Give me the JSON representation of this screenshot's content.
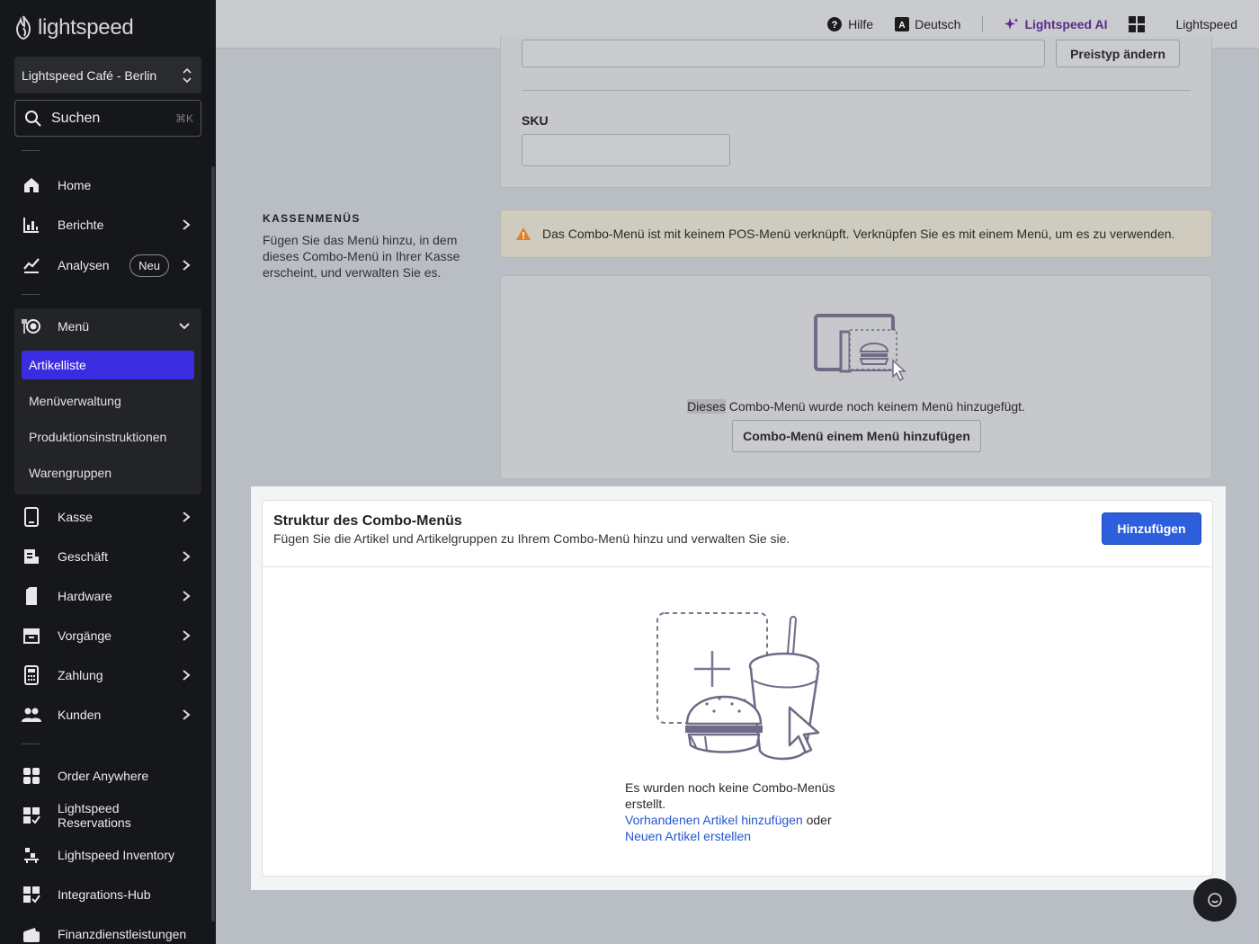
{
  "sidebar": {
    "logo_text": "lightspeed",
    "store_name": "Lightspeed Café - Berlin",
    "search": {
      "label": "Suchen",
      "shortcut": "⌘K"
    },
    "nav": [
      {
        "label": "Home",
        "icon": "home-icon"
      },
      {
        "label": "Berichte",
        "icon": "reports-icon"
      },
      {
        "label": "Analysen",
        "icon": "analytics-icon",
        "badge": "Neu"
      }
    ],
    "menu": {
      "label": "Menü",
      "icon": "menu-icon",
      "items": [
        "Artikelliste",
        "Menüverwaltung",
        "Produktionsinstruktionen",
        "Warengruppen"
      ],
      "active_item": "Artikelliste"
    },
    "nav2": [
      {
        "label": "Kasse",
        "icon": "pos-device-icon"
      },
      {
        "label": "Geschäft",
        "icon": "business-icon"
      },
      {
        "label": "Hardware",
        "icon": "hardware-icon"
      },
      {
        "label": "Vorgänge",
        "icon": "transactions-icon"
      },
      {
        "label": "Zahlung",
        "icon": "payment-terminal-icon"
      },
      {
        "label": "Kunden",
        "icon": "customers-icon"
      }
    ],
    "nav3": [
      {
        "label": "Order Anywhere",
        "icon": "order-anywhere-icon"
      },
      {
        "label": "Lightspeed Reservations",
        "icon": "reservations-icon"
      },
      {
        "label": "Lightspeed Inventory",
        "icon": "inventory-icon"
      },
      {
        "label": "Integrations-Hub",
        "icon": "integrations-icon"
      },
      {
        "label": "Finanzdienstleistungen",
        "icon": "wallet-icon"
      }
    ]
  },
  "topbar": {
    "help": "Hilfe",
    "language": "Deutsch",
    "ai": "Lightspeed AI",
    "account": "Lightspeed"
  },
  "pricing": {
    "change_price_type": "Preistyp ändern"
  },
  "sku": {
    "label": "SKU",
    "value": ""
  },
  "pos_menus": {
    "title": "KASSENMENÜS",
    "description": "Fügen Sie das Menü hinzu, in dem dieses Combo-Menü in Ihrer Kasse erscheint, und verwalten Sie es.",
    "warning": "Das Combo-Menü ist mit keinem POS-Menü verknüpft. Verknüpfen Sie es mit einem Menü, um es zu verwenden.",
    "empty_highlight": "Dieses",
    "empty_rest": " Combo-Menü wurde noch keinem Menü hinzugefügt.",
    "add_button": "Combo-Menü einem Menü hinzufügen"
  },
  "structure": {
    "title": "Struktur des Combo-Menüs",
    "subtitle": "Fügen Sie die Artikel und Artikelgruppen zu Ihrem Combo-Menü hinzu und verwalten Sie sie.",
    "add_button": "Hinzufügen",
    "empty_text": "Es wurden noch keine Combo-Menüs erstellt.",
    "link_existing": "Vorhandenen Artikel hinzufügen",
    "or": " oder ",
    "link_new": "Neuen Artikel erstellen"
  },
  "colors": {
    "sidebar_bg": "#16171a",
    "active_item": "#3a2ce0",
    "primary_button": "#2d5fdd",
    "link": "#2456cf",
    "ai_accent": "#5b2a8e",
    "warning": "#d9822b"
  }
}
